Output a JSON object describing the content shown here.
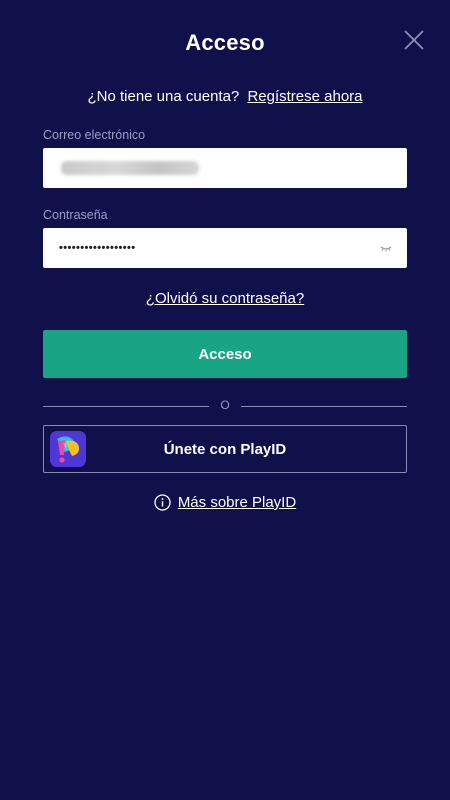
{
  "title": "Acceso",
  "close_icon": "close-icon",
  "register": {
    "question": "¿No tiene una cuenta?",
    "link": "Regístrese ahora"
  },
  "email": {
    "label": "Correo electrónico",
    "value_obscured": true
  },
  "password": {
    "label": "Contraseña",
    "value": "••••••••••••••••••",
    "toggle_icon": "chevron-down-icon"
  },
  "forgot_link": "¿Olvidó su contraseña?",
  "login_button": "Acceso",
  "divider_text": "O",
  "playid": {
    "button_label": "Únete con PlayID",
    "logo_icon": "playid-logo-icon"
  },
  "more": {
    "icon": "info-icon",
    "link": "Más sobre PlayID"
  },
  "colors": {
    "background": "#10104a",
    "primary_button": "#18a584",
    "muted_text": "#9d9dc4",
    "border": "#8a8ab2"
  }
}
